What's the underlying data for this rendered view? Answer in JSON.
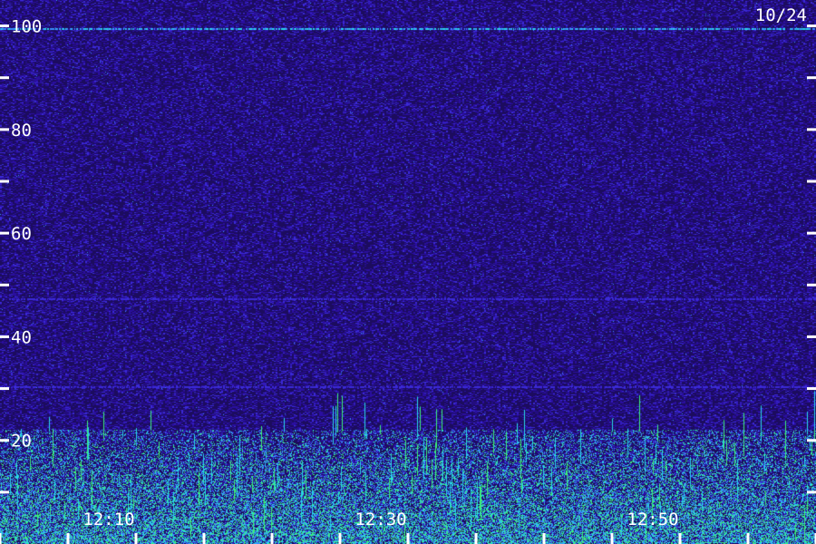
{
  "chart_data": {
    "type": "heatmap",
    "title": "",
    "date_label": "10/24",
    "xlabel": "",
    "ylabel": "",
    "y_range": [
      0,
      105
    ],
    "y_ticks_major": [
      20,
      40,
      60,
      80,
      100
    ],
    "y_ticks_minor": [
      10,
      30,
      50,
      70,
      90
    ],
    "y_tick_labels": [
      "20",
      "40",
      "60",
      "80",
      "100"
    ],
    "x_tick_labels": [
      {
        "minutes": 10,
        "label": "12:10"
      },
      {
        "minutes": 30,
        "label": "12:30"
      },
      {
        "minutes": 50,
        "label": "12:50"
      }
    ],
    "x_range_minutes": [
      2,
      62
    ],
    "x_tick_interval_minutes": 5,
    "colors": {
      "background": "#1c0c5e",
      "noise_low": "#2a0fa0",
      "noise_mid": "#3b2ad8",
      "signal_blue": "#3a8cff",
      "signal_cyan": "#28d8e8",
      "signal_green": "#3cf07a",
      "tick": "#ffffff"
    },
    "features": [
      {
        "kind": "horizontal_line",
        "y": 99.5,
        "intensity": "cyan"
      },
      {
        "kind": "horizontal_line",
        "y": 47.5,
        "intensity": "blue"
      },
      {
        "kind": "horizontal_line",
        "y": 30.5,
        "intensity": "blue"
      },
      {
        "kind": "dense_band",
        "y_from": 0,
        "y_to": 22,
        "intensity": "green"
      }
    ]
  }
}
